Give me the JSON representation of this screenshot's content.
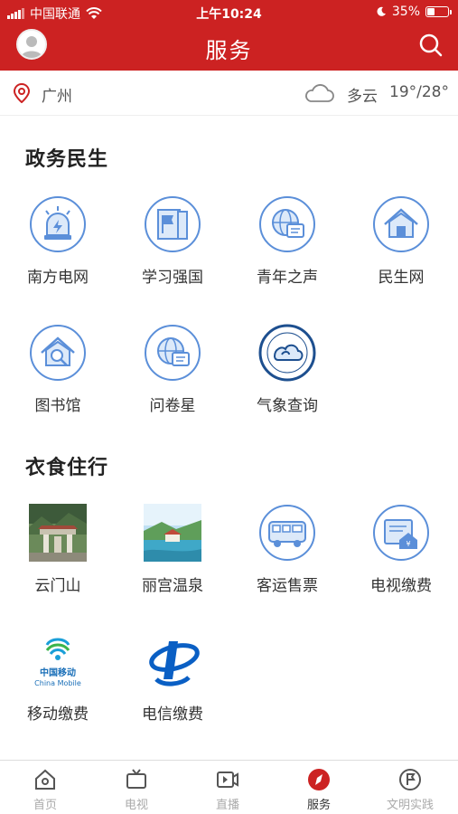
{
  "status_bar": {
    "carrier": "中国联通",
    "time": "上午10:24",
    "battery": "35%"
  },
  "header": {
    "title": "服务"
  },
  "location": {
    "city": "广州",
    "weather": "多云",
    "temperature": "19°/28°"
  },
  "sections": [
    {
      "title": "政务民生",
      "items": [
        {
          "label": "南方电网",
          "icon": "lightning-icon"
        },
        {
          "label": "学习强国",
          "icon": "study-icon"
        },
        {
          "label": "青年之声",
          "icon": "youth-voice-icon"
        },
        {
          "label": "民生网",
          "icon": "house-icon"
        },
        {
          "label": "图书馆",
          "icon": "library-icon"
        },
        {
          "label": "问卷星",
          "icon": "survey-icon"
        },
        {
          "label": "气象查询",
          "icon": "weather-bureau-icon"
        }
      ]
    },
    {
      "title": "衣食住行",
      "items": [
        {
          "label": "云门山",
          "icon": "yunmen-mountain-photo"
        },
        {
          "label": "丽宫温泉",
          "icon": "hot-spring-photo"
        },
        {
          "label": "客运售票",
          "icon": "bus-icon"
        },
        {
          "label": "电视缴费",
          "icon": "tv-bill-icon"
        },
        {
          "label": "移动缴费",
          "icon": "china-mobile-logo"
        },
        {
          "label": "电信缴费",
          "icon": "china-telecom-logo"
        }
      ]
    }
  ],
  "china_mobile_logo": {
    "cn": "中国移动",
    "en": "China Mobile"
  },
  "tabbar": [
    {
      "label": "首页",
      "icon": "home-icon"
    },
    {
      "label": "电视",
      "icon": "tv-icon"
    },
    {
      "label": "直播",
      "icon": "live-icon"
    },
    {
      "label": "服务",
      "icon": "compass-icon",
      "active": true
    },
    {
      "label": "文明实践",
      "icon": "civilization-icon"
    }
  ],
  "colors": {
    "brand": "#cc2222",
    "icon_blue": "#5b8fd9",
    "icon_fill": "#dce9f9"
  }
}
